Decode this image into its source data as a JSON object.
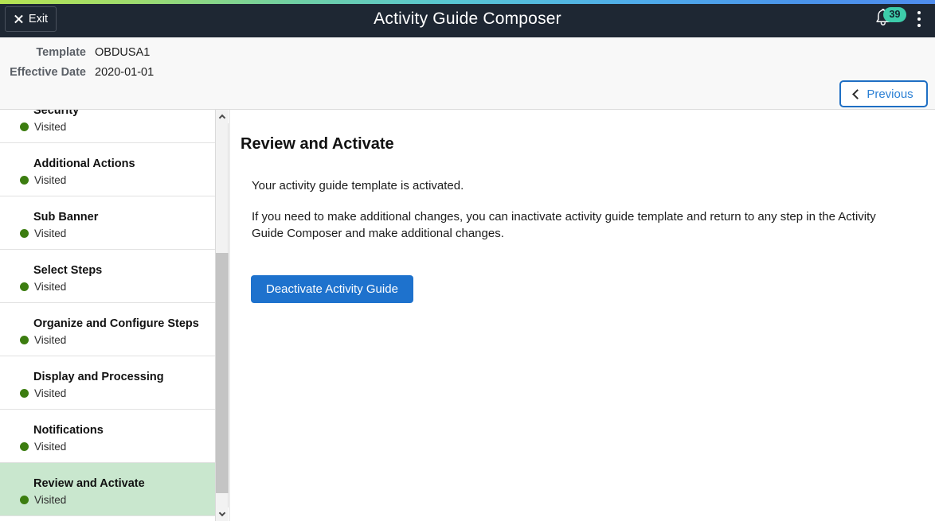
{
  "titlebar": {
    "exit_label": "Exit",
    "app_title": "Activity Guide Composer",
    "notification_count": "39"
  },
  "subheader": {
    "template_label": "Template",
    "template_value": "OBDUSA1",
    "effective_date_label": "Effective Date",
    "effective_date_value": "2020-01-01",
    "previous_label": "Previous"
  },
  "sidebar": {
    "steps": [
      {
        "title": "Security",
        "status": "Visited",
        "active": false
      },
      {
        "title": "Additional Actions",
        "status": "Visited",
        "active": false
      },
      {
        "title": "Sub Banner",
        "status": "Visited",
        "active": false
      },
      {
        "title": "Select Steps",
        "status": "Visited",
        "active": false
      },
      {
        "title": "Organize and Configure Steps",
        "status": "Visited",
        "active": false
      },
      {
        "title": "Display and Processing",
        "status": "Visited",
        "active": false
      },
      {
        "title": "Notifications",
        "status": "Visited",
        "active": false
      },
      {
        "title": "Review and Activate",
        "status": "Visited",
        "active": true
      }
    ]
  },
  "content": {
    "title": "Review and Activate",
    "paragraph_1": "Your activity guide template is activated.",
    "paragraph_2": "If you need to make additional changes, you can inactivate activity guide template and return to any step in the Activity Guide Composer and make additional changes.",
    "deactivate_label": "Deactivate Activity Guide"
  },
  "colors": {
    "titlebar_bg": "#1e2733",
    "accent_blue": "#1e72cd",
    "badge_teal": "#3dccaa",
    "visited_green": "#3c7d10",
    "active_step_bg": "#c9e7ce",
    "previous_border": "#1f6fc4"
  }
}
